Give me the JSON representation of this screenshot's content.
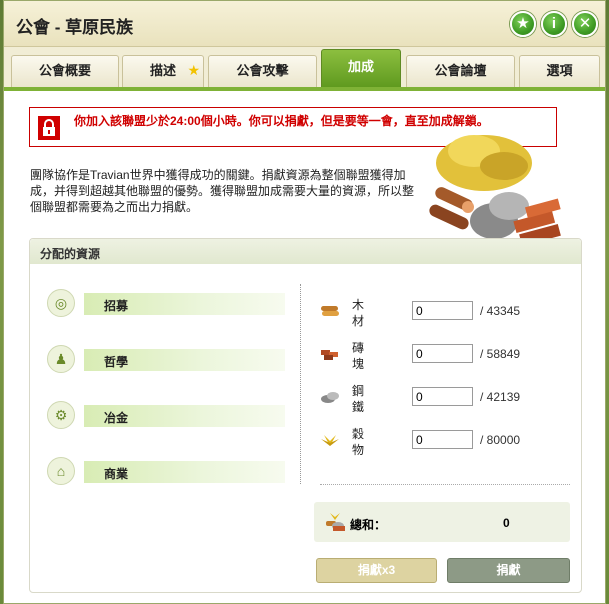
{
  "window": {
    "title": "公會 - 草原民族"
  },
  "title_buttons": [
    {
      "icon": "star-icon",
      "glyph": "★"
    },
    {
      "icon": "info-icon",
      "glyph": "i"
    },
    {
      "icon": "close-icon",
      "glyph": "✕"
    }
  ],
  "tabs": [
    {
      "label": "公會概要",
      "active": false
    },
    {
      "label": "描述",
      "active": false,
      "star": "★"
    },
    {
      "label": "公會攻擊",
      "active": false
    },
    {
      "label": "加成",
      "active": true
    },
    {
      "label": "公會論壇",
      "active": false
    },
    {
      "label": "選項",
      "active": false
    }
  ],
  "alert": {
    "text": "你加入該聯盟少於24:00個小時。你可以捐獻，但是要等一會，直至加成解鎖。"
  },
  "description": "團隊協作是Travian世界中獲得成功的關鍵。捐獻資源為整個聯盟獲得加成，并得到超越其他聯盟的優勢。獲得聯盟加成需要大量的資源，所以整個聯盟都需要為之而出力捐獻。",
  "panel": {
    "heading": "分配的資源",
    "categories": [
      {
        "label": "招募",
        "icon": "target-icon",
        "glyph": "◎"
      },
      {
        "label": "哲學",
        "icon": "philosopher-icon",
        "glyph": "♟"
      },
      {
        "label": "冶金",
        "icon": "gear-icon",
        "glyph": "⚙"
      },
      {
        "label": "商業",
        "icon": "market-icon",
        "glyph": "⌂"
      }
    ],
    "resources": [
      {
        "name": "木材",
        "icon": "wood-icon",
        "value": "0",
        "max": "/ 43345"
      },
      {
        "name": "磚塊",
        "icon": "clay-icon",
        "value": "0",
        "max": "/ 58849"
      },
      {
        "name": "鋼鐵",
        "icon": "iron-icon",
        "value": "0",
        "max": "/ 42139"
      },
      {
        "name": "穀物",
        "icon": "crop-icon",
        "value": "0",
        "max": "/ 80000"
      }
    ],
    "total": {
      "label": "總和：",
      "value": "0"
    },
    "buttons": {
      "donate_x3": "捐獻x3",
      "donate": "捐獻"
    }
  },
  "colors": {
    "accent": "#7fb236",
    "alert": "#d00000"
  }
}
